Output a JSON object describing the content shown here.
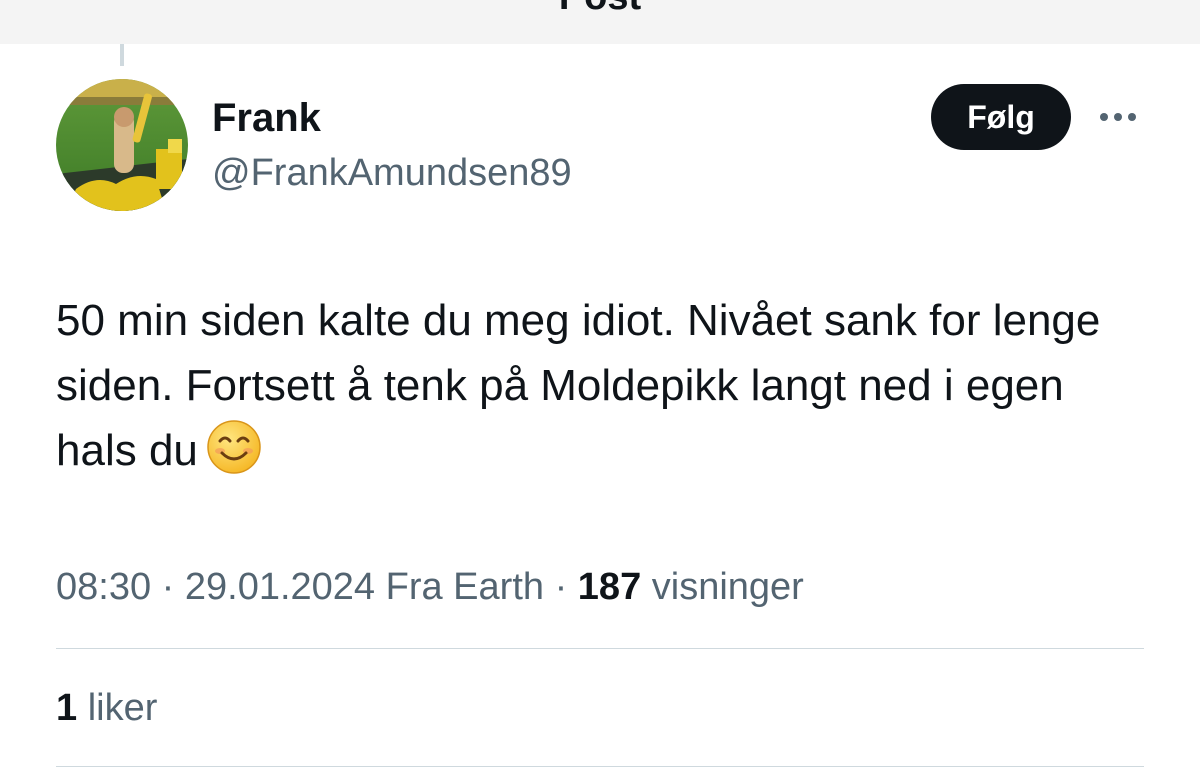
{
  "header": {
    "title": "Post",
    "back_icon": "arrow-left-icon"
  },
  "author": {
    "display_name": "Frank",
    "handle": "@FrankAmundsen89",
    "avatar_icon": "avatar-stadium-photo"
  },
  "follow_button": {
    "label": "Følg"
  },
  "more_icon": "ellipsis-icon",
  "post": {
    "text": "50 min siden kalte du meg idiot. Nivået sank for lenge siden. Fortsett å tenk på Moldepikk langt ned i egen hals du",
    "emoji": "smiling-face-icon"
  },
  "meta": {
    "time": "08:30",
    "separator": "·",
    "date": "29.01.2024",
    "source": "Fra Earth",
    "views_count": "187",
    "views_label": "visninger"
  },
  "stats": {
    "likes_count": "1",
    "likes_label": "liker"
  },
  "colors": {
    "text_primary": "#0f1419",
    "text_secondary": "#536471",
    "button_bg": "#0f1419",
    "divider": "#cfd9de"
  }
}
